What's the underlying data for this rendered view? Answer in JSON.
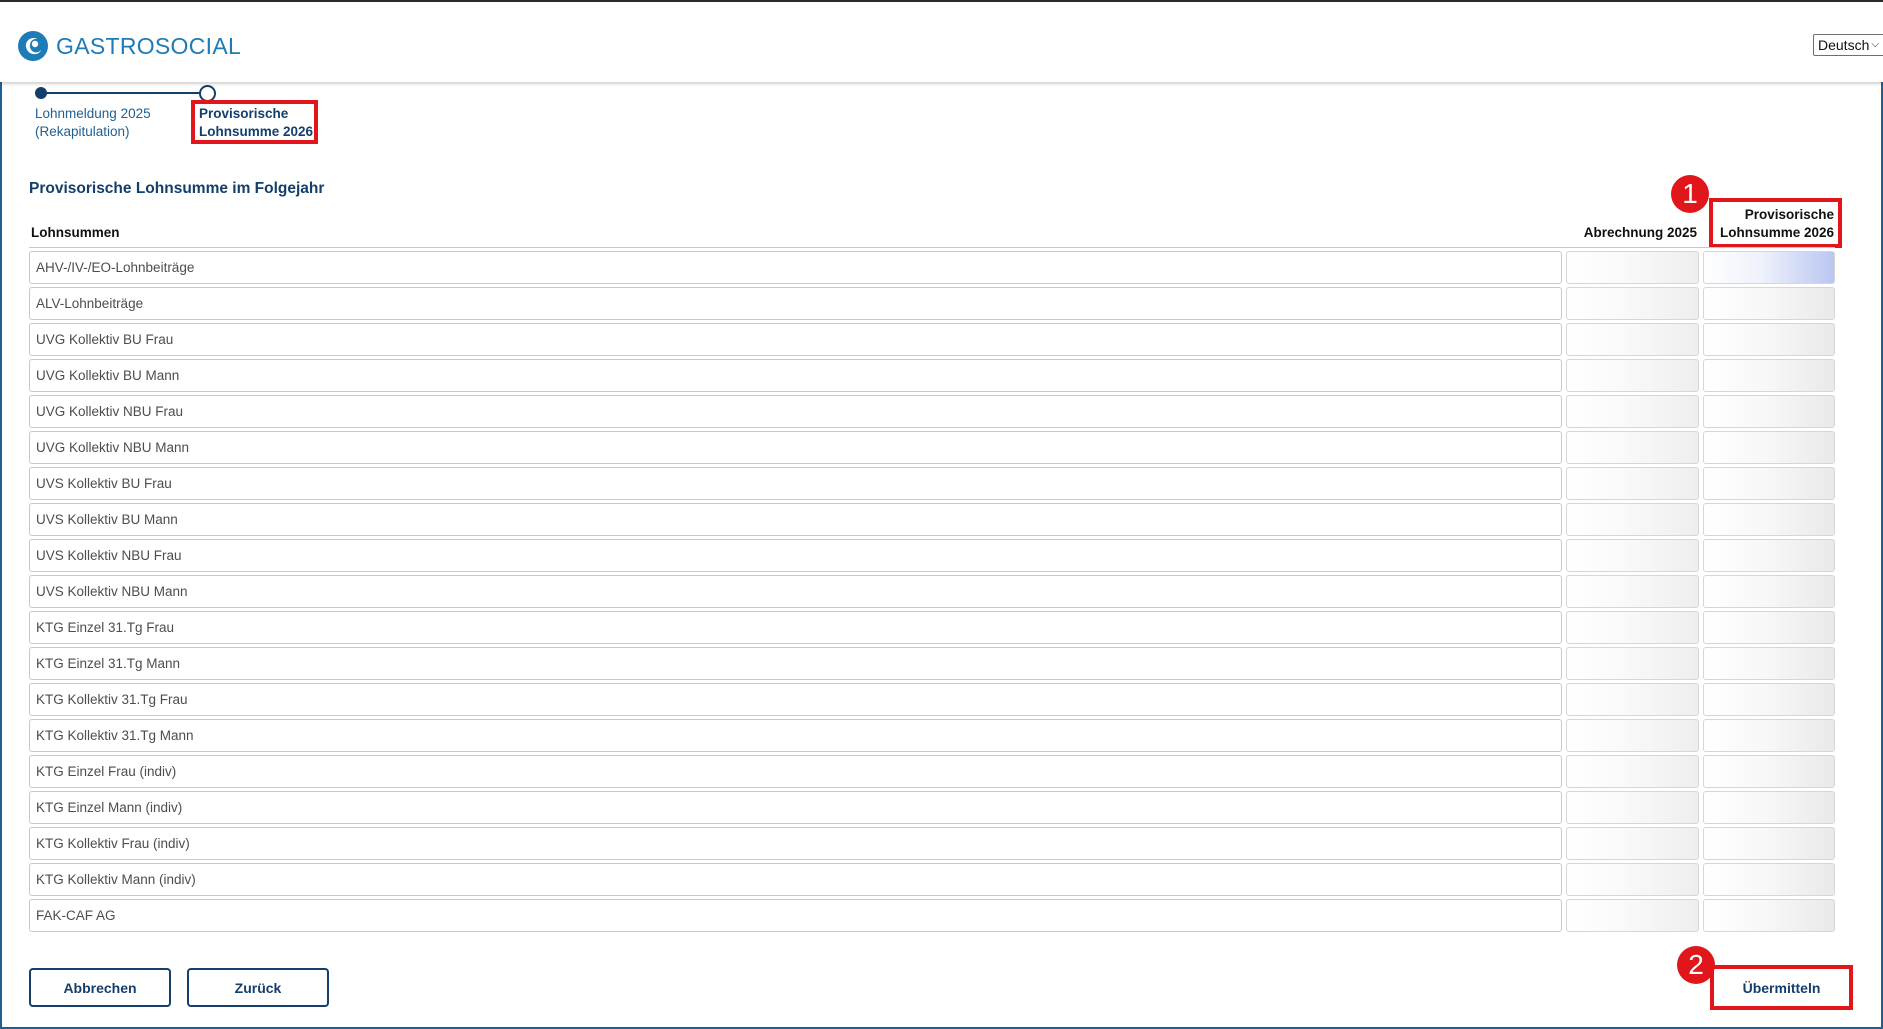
{
  "header": {
    "logo_text": "GASTROSOCIAL",
    "language": "Deutsch",
    "brand_color": "#1d7bb8"
  },
  "stepper": {
    "steps": [
      {
        "label_line1": "Lohnmeldung 2025",
        "label_line2": "(Rekapitulation)",
        "state": "done"
      },
      {
        "label_line1": "Provisorische",
        "label_line2": "Lohnsumme 2026",
        "state": "current"
      }
    ]
  },
  "main": {
    "title": "Provisorische Lohnsumme im Folgejahr",
    "columns": {
      "lohnsummen": "Lohnsummen",
      "abrechnung": "Abrechnung 2025",
      "provisorisch_line1": "Provisorische",
      "provisorisch_line2": "Lohnsumme 2026"
    },
    "rows": [
      "AHV-/IV-/EO-Lohnbeiträge",
      "ALV-Lohnbeiträge",
      "UVG Kollektiv BU Frau",
      "UVG Kollektiv BU Mann",
      "UVG Kollektiv NBU Frau",
      "UVG Kollektiv NBU Mann",
      "UVS Kollektiv BU Frau",
      "UVS Kollektiv BU Mann",
      "UVS Kollektiv NBU Frau",
      "UVS Kollektiv NBU Mann",
      "KTG Einzel 31.Tg Frau",
      "KTG Einzel 31.Tg Mann",
      "KTG Kollektiv 31.Tg Frau",
      "KTG Kollektiv 31.Tg Mann",
      "KTG Einzel Frau (indiv)",
      "KTG Einzel Mann (indiv)",
      "KTG Kollektiv Frau (indiv)",
      "KTG Kollektiv Mann (indiv)",
      "FAK-CAF AG"
    ]
  },
  "buttons": {
    "cancel": "Abbrechen",
    "back": "Zurück",
    "submit": "Übermitteln"
  },
  "annotations": {
    "badge1": "1",
    "badge2": "2",
    "highlight_color": "#e0161b"
  }
}
